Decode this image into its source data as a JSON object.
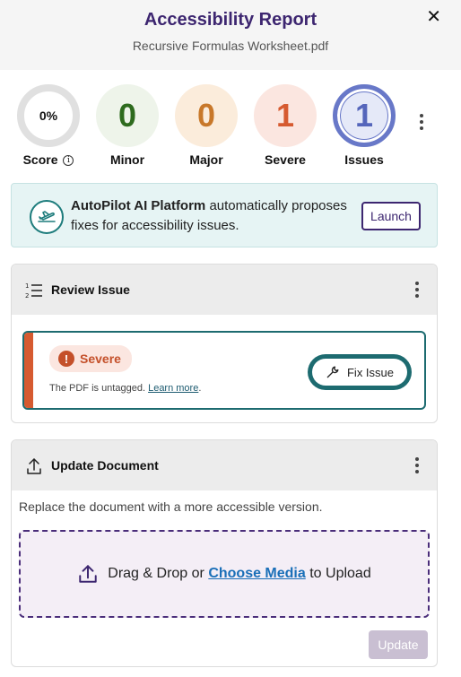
{
  "header": {
    "title": "Accessibility Report",
    "subtitle": "Recursive Formulas Worksheet.pdf",
    "close_label": "✕"
  },
  "stats": {
    "score": {
      "value": "0%",
      "label": "Score"
    },
    "minor": {
      "value": "0",
      "label": "Minor"
    },
    "major": {
      "value": "0",
      "label": "Major"
    },
    "severe": {
      "value": "1",
      "label": "Severe"
    },
    "issues": {
      "value": "1",
      "label": "Issues"
    }
  },
  "autopilot": {
    "name": "AutoPilot AI Platform",
    "text": " automatically proposes fixes for accessibility issues.",
    "button": "Launch"
  },
  "review": {
    "title": "Review Issue",
    "severity": "Severe",
    "description": "The PDF is untagged.",
    "link": "Learn more",
    "period": ".",
    "fix_button": "Fix Issue"
  },
  "update": {
    "title": "Update Document",
    "description": "Replace the document with a more accessible version.",
    "drop_before": "Drag & Drop or",
    "drop_link": "Choose Media",
    "drop_after": "to Upload",
    "button": "Update"
  },
  "colors": {
    "brand": "#3d2670",
    "teal": "#1d6b70",
    "severe": "#d65a30",
    "minor": "#2e6b1e",
    "major": "#c8782a",
    "issues": "#6878c8"
  }
}
